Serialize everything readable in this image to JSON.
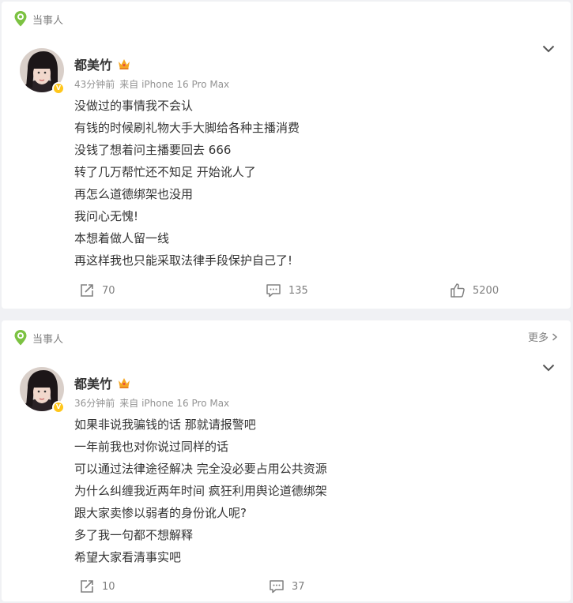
{
  "posts": [
    {
      "tag": "当事人",
      "author": "都美竹",
      "time": "43分钟前",
      "source": "来自 iPhone 16 Pro Max",
      "lines": [
        "没做过的事情我不会认",
        "有钱的时候刷礼物大手大脚给各种主播消费",
        "没钱了想着问主播要回去 666",
        "转了几万帮忙还不知足 开始讹人了",
        "再怎么道德绑架也没用",
        "我问心无愧!",
        "本想着做人留一线",
        "再这样我也只能采取法律手段保护自己了!"
      ],
      "reposts": "70",
      "comments": "135",
      "likes": "5200",
      "verified": "V"
    },
    {
      "tag": "当事人",
      "more": "更多",
      "author": "都美竹",
      "time": "36分钟前",
      "source": "来自 iPhone 16 Pro Max",
      "lines": [
        "如果非说我骗钱的话 那就请报警吧",
        "一年前我也对你说过同样的话",
        "可以通过法律途径解决 完全没必要占用公共资源",
        "为什么纠缠我近两年时间 疯狂利用舆论道德绑架",
        "跟大家卖惨以弱者的身份讹人呢?",
        "多了我一句都不想解释",
        "希望大家看清事实吧"
      ],
      "reposts": "10",
      "comments": "37",
      "verified": "V"
    }
  ],
  "colors": {
    "tag_green": "#7cc242",
    "verified": "#ffc61a",
    "crown": "#f5a623"
  }
}
